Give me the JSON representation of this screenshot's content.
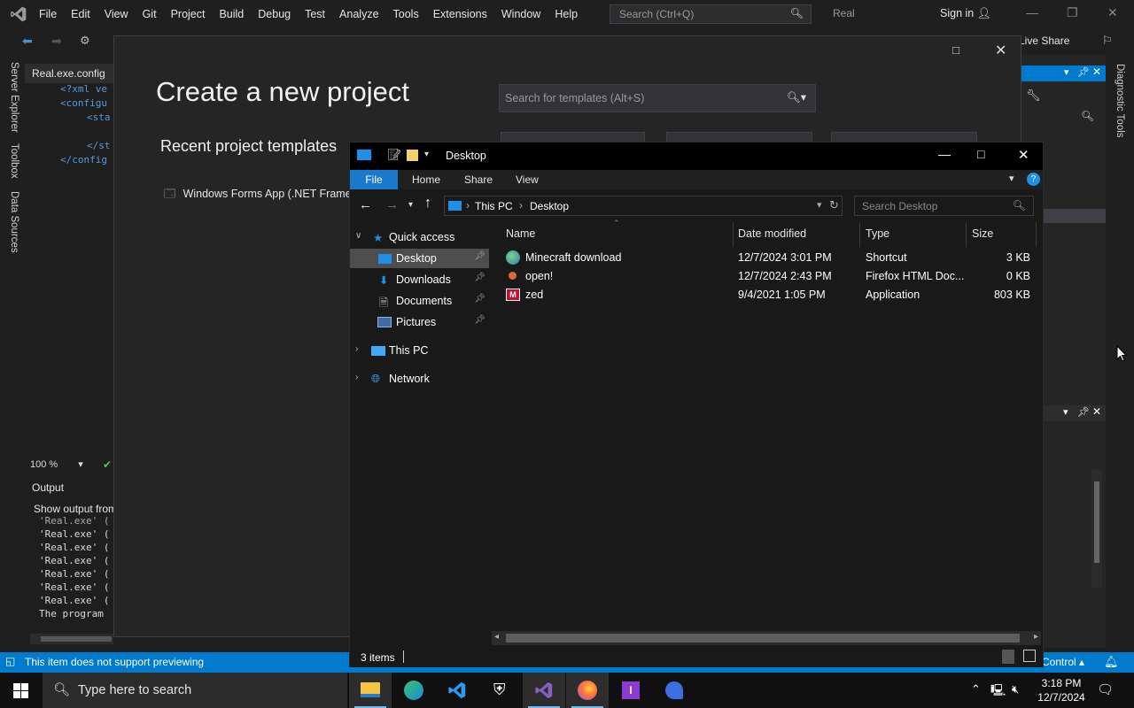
{
  "vs": {
    "menu": [
      "File",
      "Edit",
      "View",
      "Git",
      "Project",
      "Build",
      "Debug",
      "Test",
      "Analyze",
      "Tools",
      "Extensions",
      "Window",
      "Help"
    ],
    "search_placeholder": "Search (Ctrl+Q)",
    "solution_name": "Real",
    "sign_in": "Sign in",
    "live_share": "Live Share",
    "left_tabs": [
      "Server Explorer",
      "Toolbox",
      "Data Sources"
    ],
    "right_tab": "Diagnostic Tools",
    "editor_tab": "Real.exe.config",
    "code_lines": [
      "<?xml ve",
      "<configu",
      "<sta",
      "</st",
      "</config"
    ],
    "zoom": "100 %",
    "output_title": "Output",
    "output_show": "Show output from",
    "output_lines": [
      "'Real.exe' (",
      "'Real.exe' (",
      "'Real.exe' (",
      "'Real.exe' (",
      "'Real.exe' (",
      "'Real.exe' (",
      "'Real.exe' (",
      "The program "
    ],
    "status_text": "This item does not support previewing",
    "status_right": "Control"
  },
  "create_project": {
    "title": "Create a new project",
    "recent_heading": "Recent project templates",
    "recent_item": "Windows Forms App (.NET Framew",
    "search_placeholder": "Search for templates (Alt+S)"
  },
  "explorer": {
    "title": "Desktop",
    "ribbon_tabs": [
      "File",
      "Home",
      "Share",
      "View"
    ],
    "breadcrumb": [
      "This PC",
      "Desktop"
    ],
    "search_placeholder": "Search Desktop",
    "nav": {
      "quick_access": "Quick access",
      "desktop": "Desktop",
      "downloads": "Downloads",
      "documents": "Documents",
      "pictures": "Pictures",
      "this_pc": "This PC",
      "network": "Network"
    },
    "columns": [
      "Name",
      "Date modified",
      "Type",
      "Size"
    ],
    "files": [
      {
        "name": "Minecraft download",
        "date": "12/7/2024 3:01 PM",
        "type": "Shortcut",
        "size": "3 KB"
      },
      {
        "name": "open!",
        "date": "12/7/2024 2:43 PM",
        "type": "Firefox HTML Doc...",
        "size": "0 KB"
      },
      {
        "name": "zed",
        "date": "9/4/2021 1:05 PM",
        "type": "Application",
        "size": "803 KB"
      }
    ],
    "status": "3 items"
  },
  "taskbar": {
    "search_placeholder": "Type here to search",
    "time": "3:18 PM",
    "date": "12/7/2024"
  },
  "colors": {
    "accent": "#007acc",
    "explorer_file_tab": "#1979ca",
    "vs_purple": "#865fc5"
  }
}
